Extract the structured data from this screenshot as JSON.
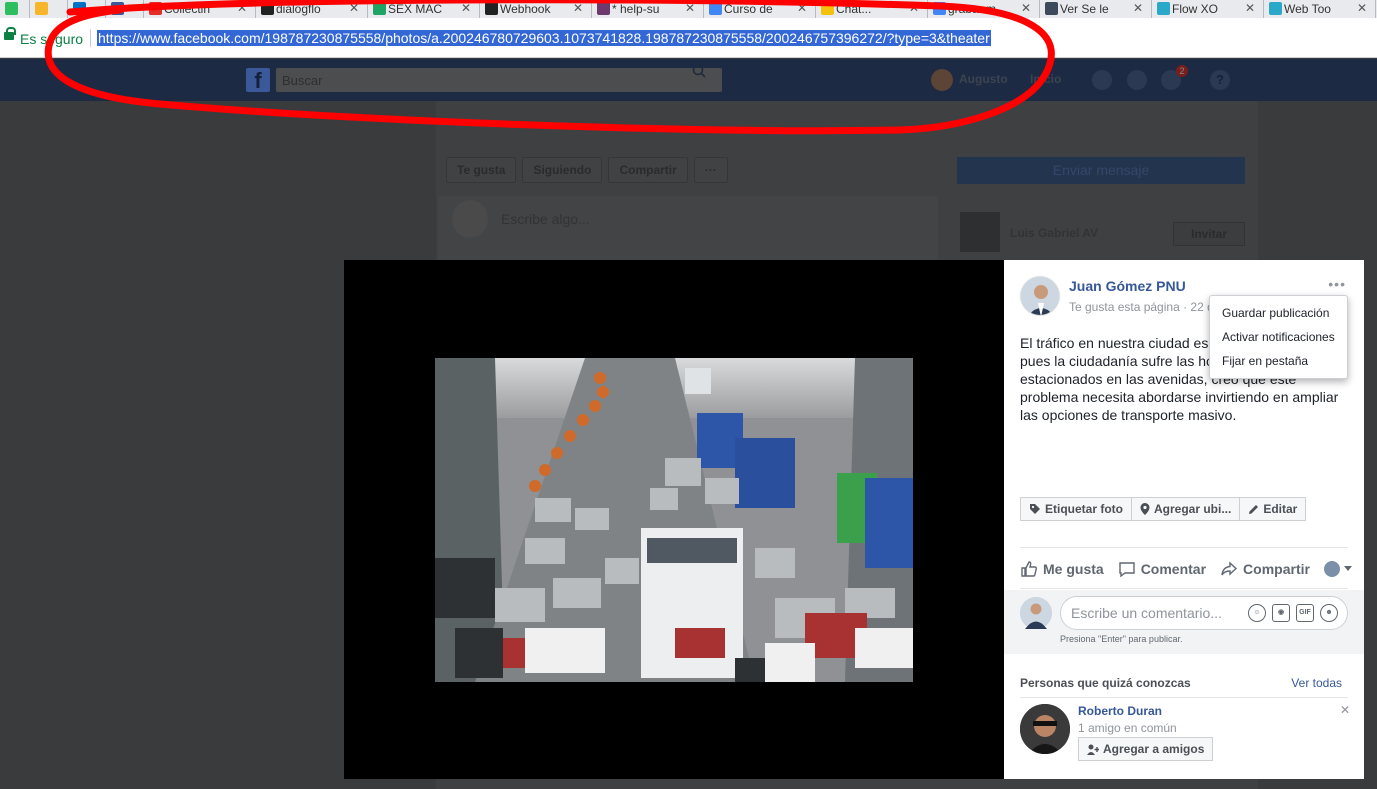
{
  "browser": {
    "tabs": [
      {
        "label": "",
        "icon": "evernote-icon",
        "color": "#2dbe60"
      },
      {
        "label": "",
        "icon": "keep-icon",
        "color": "#f7b529"
      },
      {
        "label": "",
        "icon": "outlook-icon",
        "color": "#0072c6"
      },
      {
        "label": "",
        "icon": "facebook-icon",
        "color": "#3b5998"
      },
      {
        "label": "Collectin",
        "icon": "youtube-icon",
        "color": "#e52d27"
      },
      {
        "label": "dialogflo",
        "icon": "github-icon",
        "color": "#222222"
      },
      {
        "label": "SEX MAC",
        "icon": "drive-icon",
        "color": "#1fa463"
      },
      {
        "label": "Webhook",
        "icon": "github-icon",
        "color": "#222222"
      },
      {
        "label": "* help-su",
        "icon": "slack-icon",
        "color": "#6e3a6e"
      },
      {
        "label": "Curso de",
        "icon": "google-icon",
        "color": "#4285f4"
      },
      {
        "label": "Chat...",
        "icon": "folder-icon",
        "color": "#f4c20d"
      },
      {
        "label": "grabar m",
        "icon": "google-icon",
        "color": "#4285f4"
      },
      {
        "label": "Ver Se le",
        "icon": "video-icon",
        "color": "#3c4a5c"
      },
      {
        "label": "Flow XO",
        "icon": "flowxo-icon",
        "color": "#2aa8c8"
      },
      {
        "label": "Web Too",
        "icon": "flowxo-icon",
        "color": "#2aa8c8"
      },
      {
        "label": "",
        "icon": "google-icon",
        "color": "#4285f4"
      }
    ],
    "secure_label": "Es seguro",
    "url": "https://www.facebook.com/198787230875558/photos/a.200246780729603.1073741828.198787230875558/200246757396272/?type=3&theater"
  },
  "fb_header": {
    "search_placeholder": "Buscar",
    "user_name": "Augusto",
    "home_label": "Inicio",
    "notifications_count": "2"
  },
  "page_bg": {
    "like_label": "Te gusta",
    "following_label": "Siguiendo",
    "share_label": "Compartir",
    "more_label": "···",
    "send_message_label": "Enviar mensaje",
    "write_placeholder": "Escribe algo...",
    "suggested_name": "Luis Gabriel AV",
    "invite_label": "Invitar"
  },
  "post": {
    "author": "Juan Gómez PNU",
    "meta": "Te gusta esta página · 22 de",
    "text": "El tráfico en nuestra ciudad es un problema grave, pues la ciudadanía sufre las horas de estar estacionados en las avenidas, creo que este problema necesita abordarse invirtiendo en ampliar las opciones de transporte masivo.",
    "menu": [
      "Guardar publicación",
      "Activar notificaciones",
      "Fijar en pestaña"
    ],
    "tag_buttons": {
      "tag": "Etiquetar foto",
      "location": "Agregar ubi...",
      "edit": "Editar"
    },
    "actions": {
      "like": "Me gusta",
      "comment": "Comentar",
      "share": "Compartir"
    },
    "comment_placeholder": "Escribe un comentario...",
    "comment_hint": "Presiona \"Enter\" para publicar.",
    "gif_label": "GIF"
  },
  "pymk": {
    "title": "Personas que quizá conozcas",
    "see_all": "Ver todas",
    "person": {
      "name": "Roberto Duran",
      "mutual": "1 amigo en común",
      "add_label": "Agregar a amigos"
    }
  },
  "colors": {
    "fb_blue": "#3b5998",
    "link": "#365899",
    "annotation_red": "#ff0000",
    "url_highlight": "#3367d6"
  }
}
